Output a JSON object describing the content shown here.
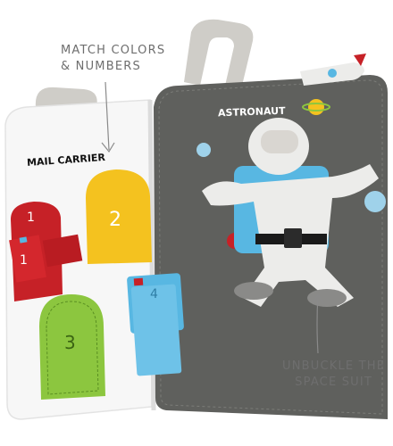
{
  "captions": {
    "top": [
      "MATCH COLORS",
      "& NUMBERS"
    ],
    "bottom": [
      "UNBUCKLE THE",
      "SPACE SUIT"
    ]
  },
  "pages": {
    "left_title": "MAIL CARRIER",
    "right_title": "ASTRONAUT"
  },
  "mail_numbers": {
    "red_box": "1",
    "red_card": "1",
    "yellow_door": "2",
    "green_door": "3",
    "blue_box": "4"
  },
  "colors": {
    "background": "#ffffff",
    "left_page": "#f7f7f7",
    "right_page": "#5f605d",
    "red": "#c62127",
    "yellow": "#f4c21f",
    "green": "#8cc63f",
    "blue": "#58b7e2",
    "grey_felt": "#d9d6d1",
    "caption_text": "#6e6e6e"
  }
}
